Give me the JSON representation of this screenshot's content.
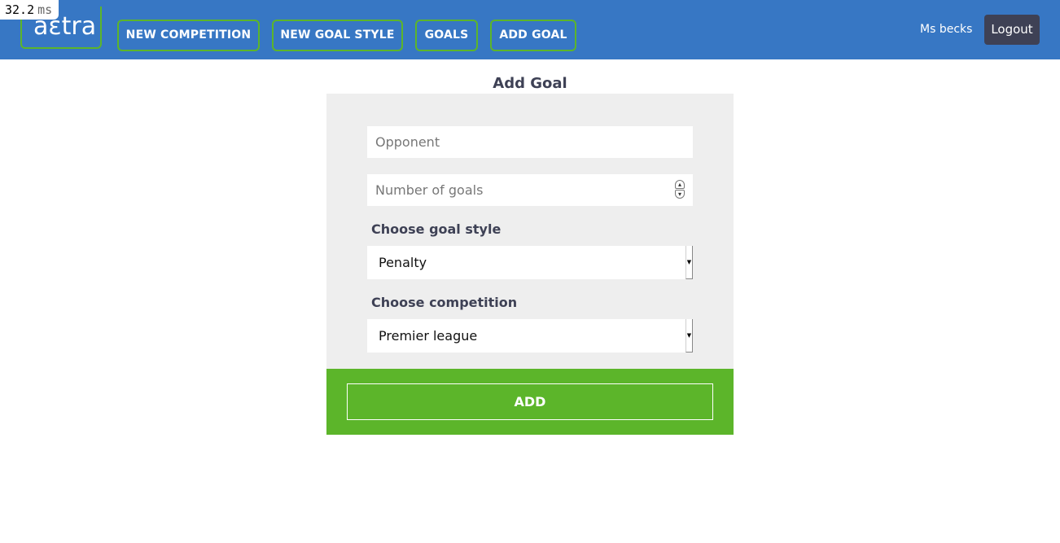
{
  "timing": {
    "value": "32.2",
    "unit": "ms"
  },
  "navbar": {
    "logo_text": "aɛtra",
    "buttons": [
      {
        "label": "NEW COMPETITION"
      },
      {
        "label": "NEW GOAL STYLE"
      },
      {
        "label": "GOALS"
      },
      {
        "label": "ADD GOAL"
      }
    ],
    "user_name": "Ms becks",
    "logout_label": "Logout",
    "background_color": "#3777c4",
    "accent_color": "#5cb52a"
  },
  "form": {
    "title": "Add Goal",
    "opponent": {
      "placeholder": "Opponent",
      "value": ""
    },
    "goals": {
      "placeholder": "Number of goals",
      "value": ""
    },
    "goal_style": {
      "label": "Choose goal style",
      "selected": "Penalty"
    },
    "competition": {
      "label": "Choose competition",
      "selected": "Premier league"
    },
    "submit_label": "ADD"
  }
}
